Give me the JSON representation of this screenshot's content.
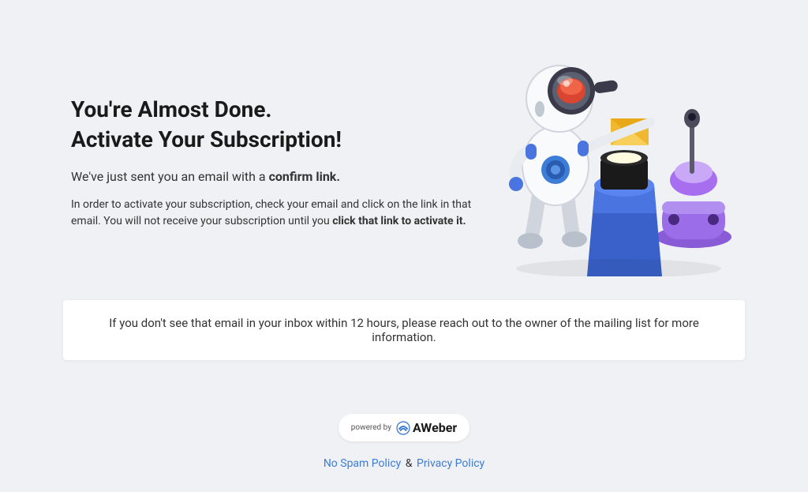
{
  "heading_line1": "You're Almost Done.",
  "heading_line2": "Activate Your Subscription!",
  "subheading_prefix": "We've just sent you an email with a ",
  "subheading_bold": "confirm link.",
  "body_prefix": "In order to activate your subscription, check your email and click on the link in that email. You will not receive your subscription until you ",
  "body_bold": "click that link to activate it.",
  "notice": "If you don't see that email in your inbox within 12 hours, please reach out to the owner of the mailing list for more information.",
  "badge_prefix": "powered by",
  "badge_brand": "AWeber",
  "link_nospam": "No Spam Policy",
  "link_amp": "&",
  "link_privacy": "Privacy Policy"
}
